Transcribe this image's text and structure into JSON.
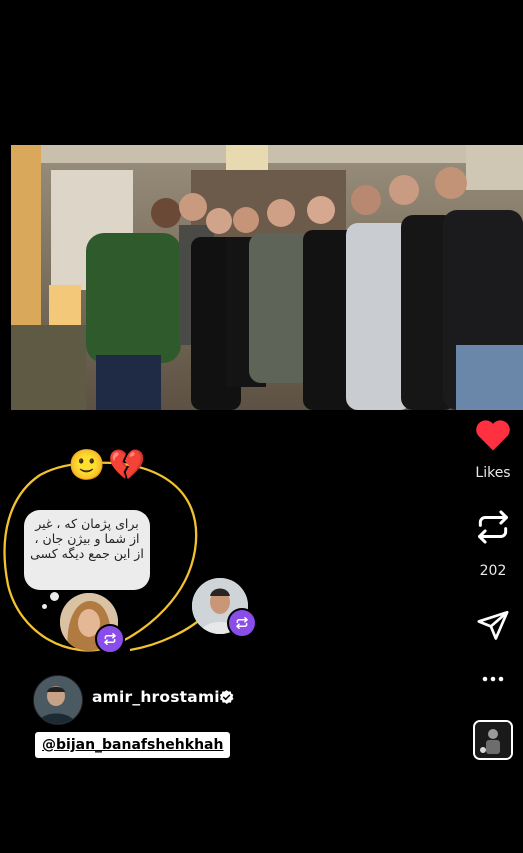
{
  "post": {
    "photo_alt_icon": "group-photo",
    "likes_label": "Likes",
    "repost_count": "202",
    "note_text": "برای پژمان که ، غیر از شما و بیژن جان ، از این جمع دیگه کسی",
    "reactions": [
      "🙂",
      "💔"
    ],
    "author": {
      "username": "amir_hrostami",
      "verified": true
    },
    "mention": "@bijan_banafshehkhah"
  },
  "colors": {
    "background": "#000000",
    "like_red": "#ff3040",
    "repost_badge": "#8a4dea",
    "highlight_yellow": "#f2c230"
  },
  "icons": [
    "heart-icon",
    "repost-icon",
    "send-icon",
    "more-icon",
    "verified-icon",
    "audio-icon"
  ]
}
